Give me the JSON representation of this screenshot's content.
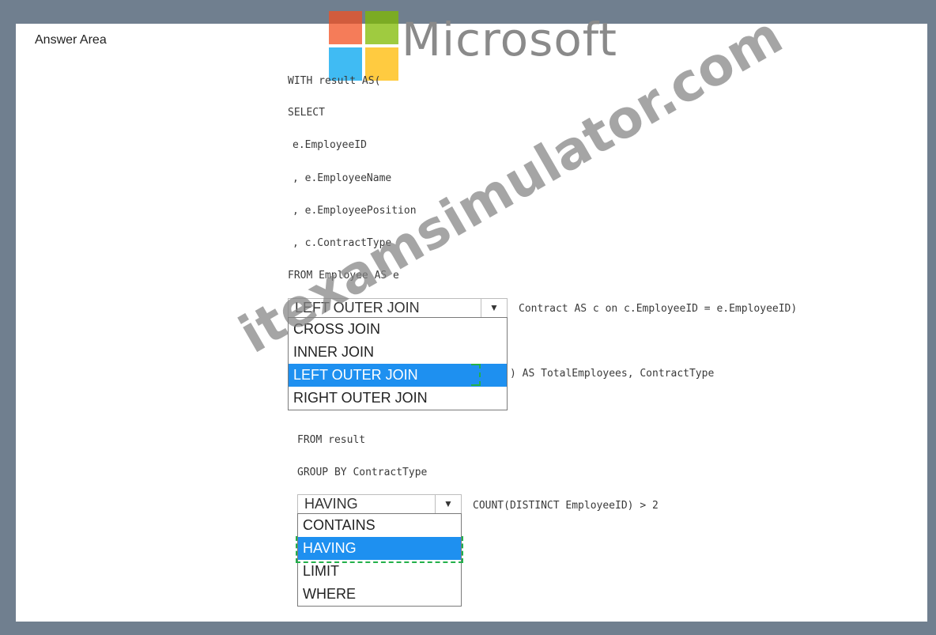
{
  "answer_area": {
    "title": "Answer Area"
  },
  "logo": {
    "word": "Microsoft",
    "colors": [
      "#f25022",
      "#7fba00",
      "#00a4ef",
      "#ffb900"
    ]
  },
  "watermark": {
    "text": "itexamsimulator.com"
  },
  "code": {
    "line1": "WITH result AS(",
    "line2": "SELECT",
    "line3": "e.EmployeeID",
    "line4": ", e.EmployeeName",
    "line5": ", e.EmployeePosition",
    "line6": ", c.ContractType",
    "line7": "FROM Employee AS e",
    "join_suffix": "Contract AS c on c.EmployeeID = e.EmployeeID)",
    "count_suffix": ") AS TotalEmployees, ContractType",
    "from_result": "FROM result",
    "group_by": "GROUP BY ContractType",
    "having_suffix": "COUNT(DISTINCT EmployeeID) > 2"
  },
  "dropdown1": {
    "selected": "LEFT OUTER JOIN",
    "options": [
      "CROSS JOIN",
      "INNER JOIN",
      "LEFT OUTER JOIN",
      "RIGHT OUTER JOIN"
    ],
    "highlighted_index": 2
  },
  "dropdown2": {
    "selected": "HAVING",
    "options": [
      "CONTAINS",
      "HAVING",
      "LIMIT",
      "WHERE"
    ],
    "highlighted_index": 1
  }
}
